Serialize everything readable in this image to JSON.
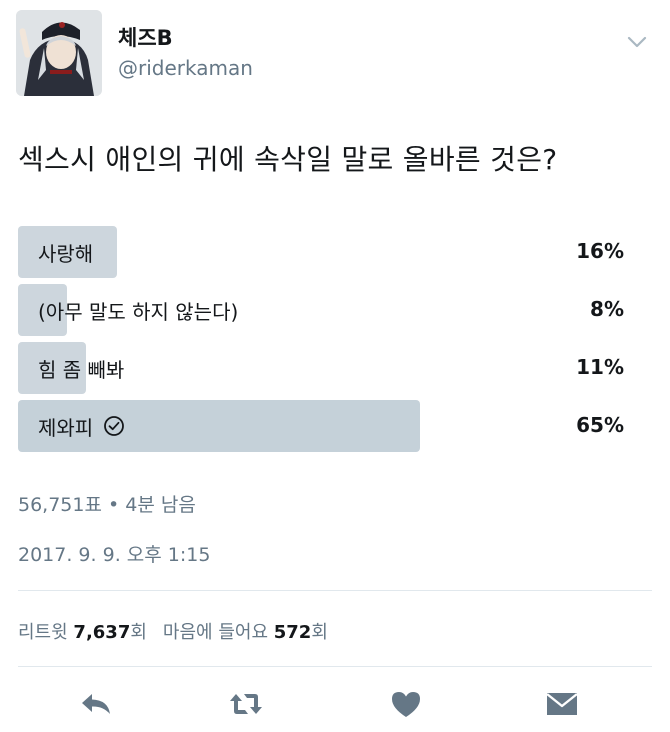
{
  "tweet": {
    "display_name": "체즈B",
    "handle": "@riderkaman",
    "question": "섹스시 애인의 귀에 속삭일 말로 올바른 것은?"
  },
  "poll": {
    "options": [
      {
        "label": "사랑해",
        "percent": 16,
        "percent_text": "16%"
      },
      {
        "label": "(아무 말도 하지 않는다)",
        "percent": 8,
        "percent_text": "8%"
      },
      {
        "label": "힘 좀 빼봐",
        "percent": 11,
        "percent_text": "11%"
      },
      {
        "label": "제와피",
        "percent": 65,
        "percent_text": "65%",
        "winner": true
      }
    ],
    "votes_text": "56,751표",
    "separator": "•",
    "time_left_text": "4분 남음"
  },
  "timestamp": "2017. 9. 9. 오후 1:15",
  "stats": {
    "retweet_label": "리트윗",
    "retweet_count": "7,637",
    "retweet_suffix": "회",
    "like_label": "마음에 들어요",
    "like_count": "572",
    "like_suffix": "회"
  },
  "icons": {
    "menu": "chevron-down-icon",
    "reply": "reply-icon",
    "retweet": "retweet-icon",
    "like": "heart-icon",
    "dm": "envelope-icon",
    "check": "check-circle-icon"
  },
  "colors": {
    "poll_bar": "#cdd6dd",
    "secondary_text": "#657786",
    "action_icon": "#657786"
  }
}
